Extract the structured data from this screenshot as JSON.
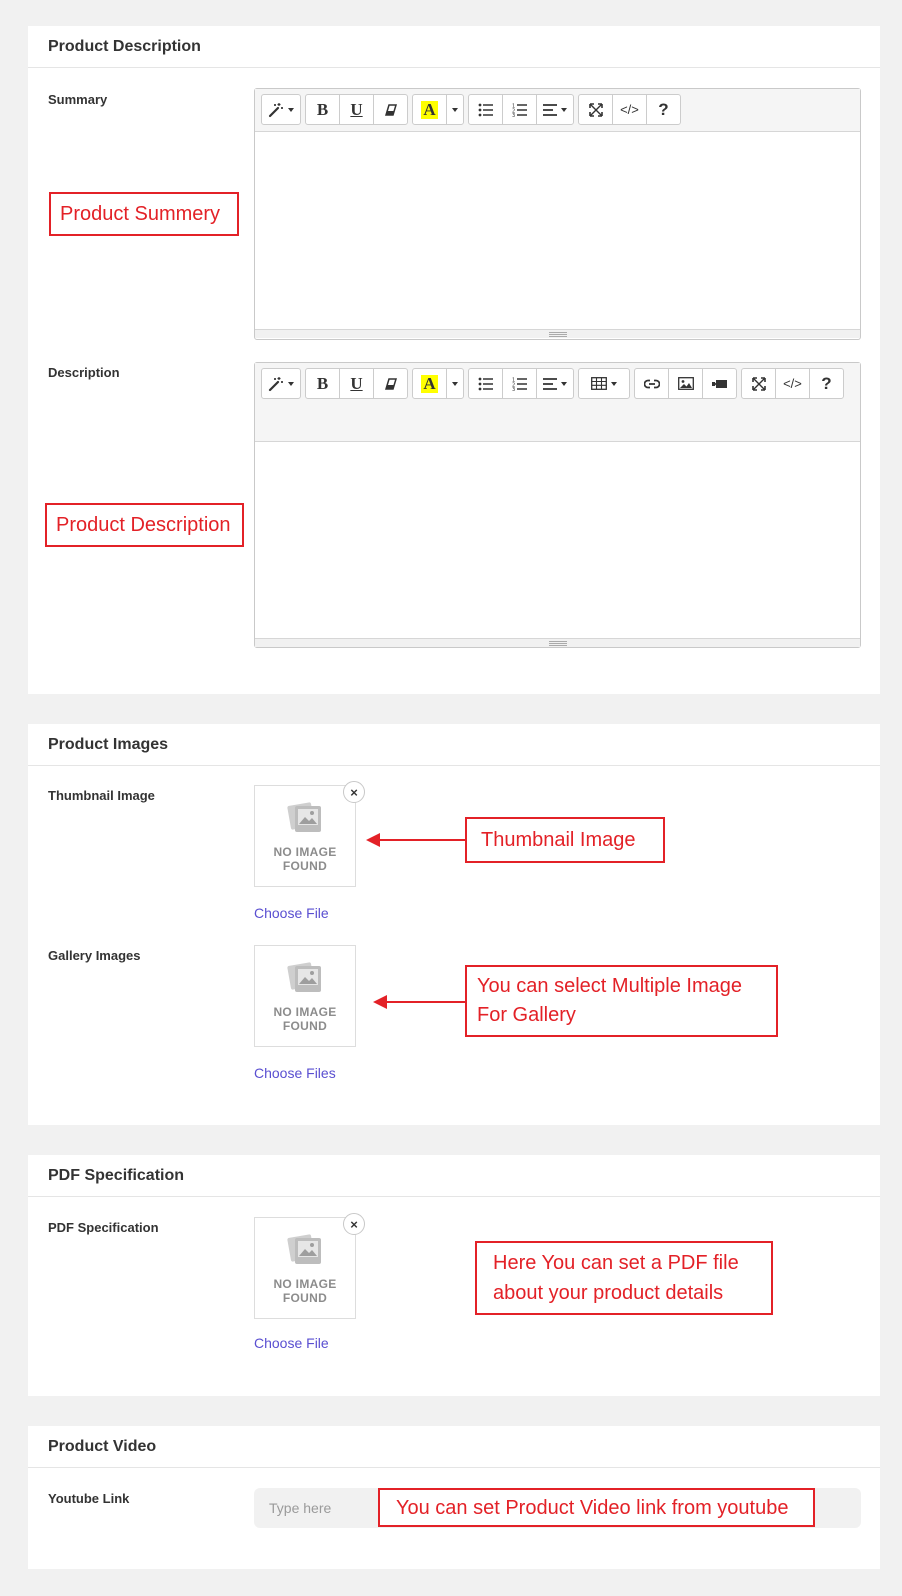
{
  "description_card": {
    "title": "Product Description",
    "summary_label": "Summary",
    "summary_annotation": "Product Summery",
    "description_label": "Description",
    "description_annotation": "Product Description"
  },
  "editor_icons": {
    "style": "magic-wand-icon",
    "bold": "B",
    "underline": "U",
    "clear": "eraser-icon",
    "color": "A",
    "help": "?",
    "code": "</>"
  },
  "images_card": {
    "title": "Product Images",
    "thumbnail_label": "Thumbnail Image",
    "thumbnail_annotation": "Thumbnail Image",
    "gallery_label": "Gallery Images",
    "gallery_annotation_line1": "You can select Multiple Image",
    "gallery_annotation_line2": "For Gallery",
    "no_image_line1": "NO IMAGE",
    "no_image_line2": "FOUND",
    "choose_file": "Choose File",
    "choose_files": "Choose Files",
    "close": "×"
  },
  "pdf_card": {
    "title": "PDF Specification",
    "field_label": "PDF Specification",
    "annotation_line1": "Here You can set a PDF file",
    "annotation_line2": "about your product details",
    "choose_file": "Choose File"
  },
  "video_card": {
    "title": "Product Video",
    "field_label": "Youtube Link",
    "placeholder": "Type here",
    "annotation": "You can set Product Video link from youtube"
  },
  "colors": {
    "annotation_red": "#e32127",
    "link_blue": "#5a4fd1",
    "page_bg": "#f1f1f1"
  }
}
